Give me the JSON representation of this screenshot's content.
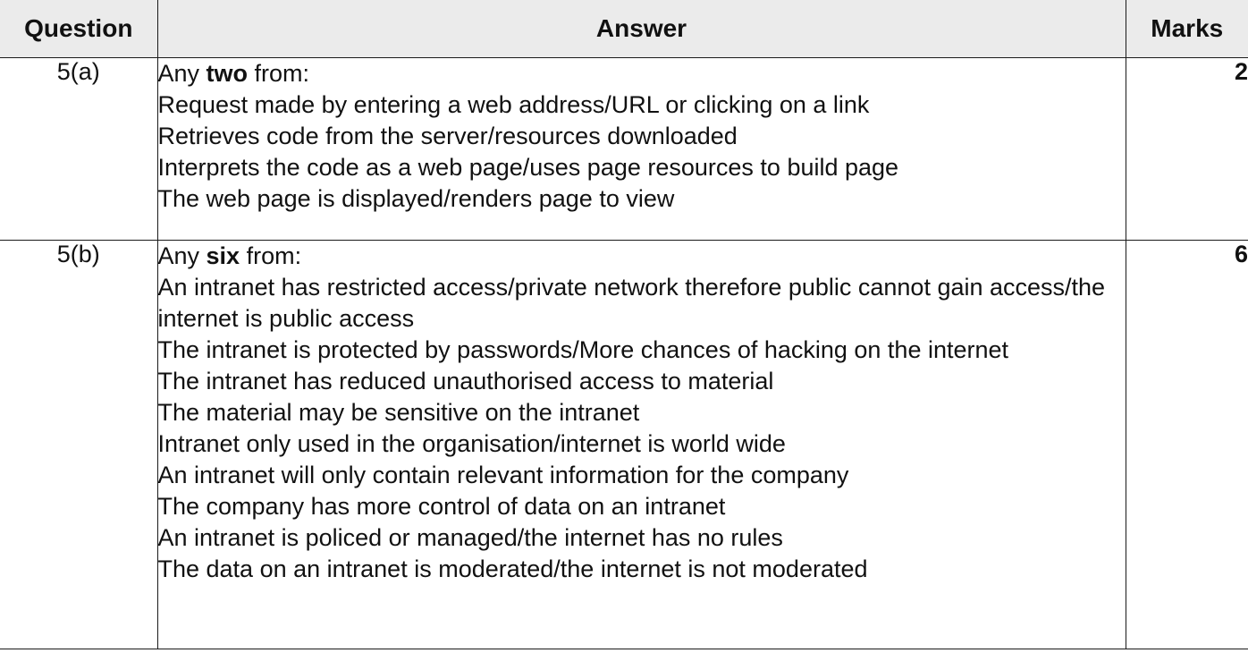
{
  "table": {
    "headers": {
      "question": "Question",
      "answer": "Answer",
      "marks": "Marks"
    },
    "rows": [
      {
        "question": "5(a)",
        "intro_pre": "Any ",
        "intro_bold": "two",
        "intro_post": " from:",
        "points": [
          "Request made by entering a web address/URL or clicking on a link",
          "Retrieves code from the server/resources downloaded",
          "Interprets the code as a web page/uses page resources to build page",
          "The web page is displayed/renders page to view"
        ],
        "marks": "2"
      },
      {
        "question": "5(b)",
        "intro_pre": "Any ",
        "intro_bold": "six",
        "intro_post": " from:",
        "points": [
          "An intranet has restricted access/private network therefore public cannot gain access/the internet is public access",
          "The intranet is protected by passwords/More chances of hacking on the internet",
          "The intranet has reduced unauthorised access to material",
          "The material may be sensitive on the intranet",
          "Intranet only used in the organisation/internet is world wide",
          "An intranet will only contain relevant information for the company",
          "The company has more control of data on an intranet",
          "An intranet is policed or managed/the internet has no rules",
          "The data on an intranet is moderated/the internet is not moderated"
        ],
        "marks": "6"
      }
    ]
  }
}
